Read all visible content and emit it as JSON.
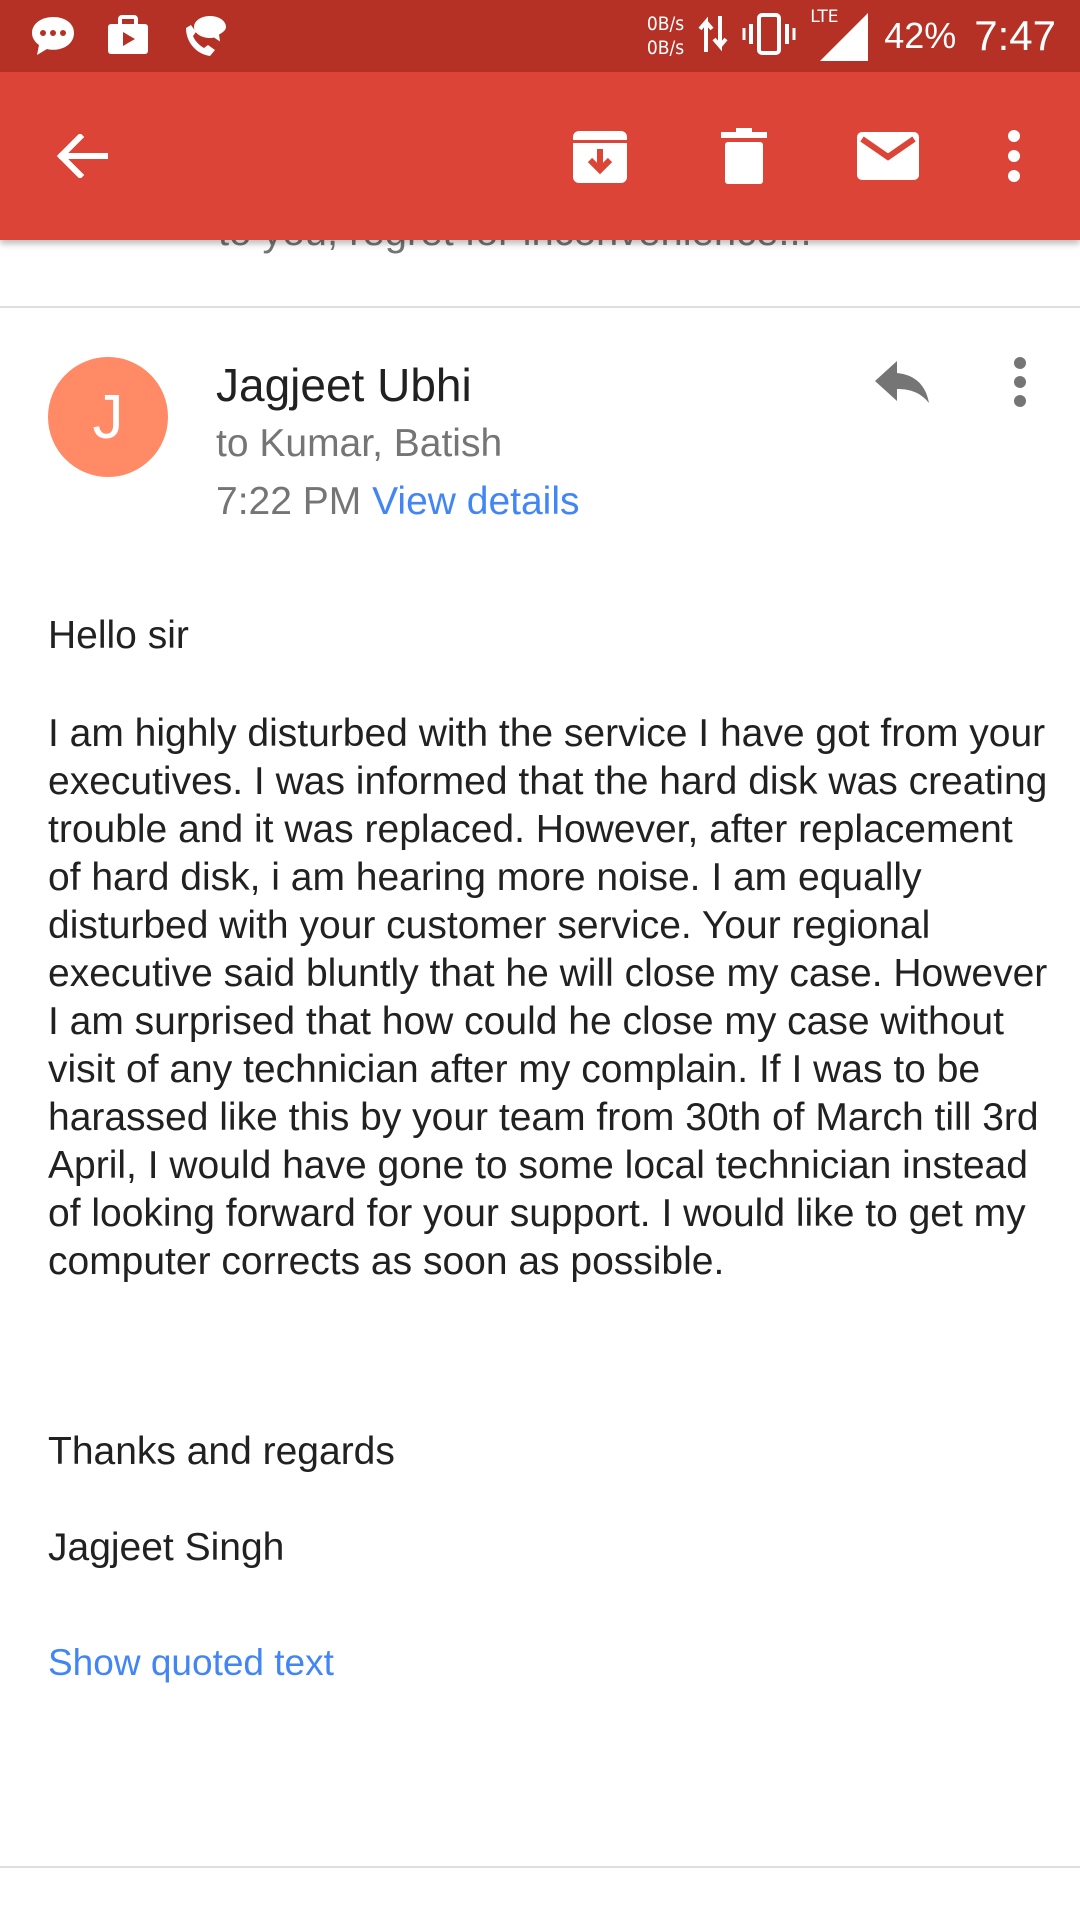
{
  "status_bar": {
    "net_up": "0B/s",
    "net_down": "0B/s",
    "network_type": "LTE",
    "battery": "42%",
    "time": "7:47",
    "left_icons": [
      "chat-bubble-icon",
      "briefcase-icon",
      "phone-chat-icon"
    ]
  },
  "toolbar": {
    "color": "#db4437",
    "icons": [
      "back-arrow-icon",
      "archive-icon",
      "delete-icon",
      "mark-unread-icon",
      "more-vert-icon"
    ]
  },
  "previous_message": {
    "snippet": "to you, regret for inconvenience..."
  },
  "message": {
    "avatar_letter": "J",
    "avatar_color": "#ff8a65",
    "sender": "Jagjeet Ubhi",
    "recipients": "to Kumar, Batish",
    "time": "7:22 PM",
    "view_details": "View details",
    "body": {
      "greeting": "Hello sir",
      "paragraph": "I am highly disturbed with the service I have got from your executives. I was informed that the hard disk was creating trouble and it was replaced. However, after replacement of hard disk, i am hearing more noise. I am equally disturbed with your customer service. Your regional executive said bluntly that he will close my case. However I am surprised that how could he close my case without visit of any technician after my complain. If I was to be harassed like this by your team from 30th of March till 3rd April, I would have gone to some local technician instead of looking forward for your support. I would like to get my computer corrects as soon as possible.",
      "closing": "Thanks and regards",
      "signature": "Jagjeet Singh"
    },
    "show_quoted": "Show quoted text"
  }
}
